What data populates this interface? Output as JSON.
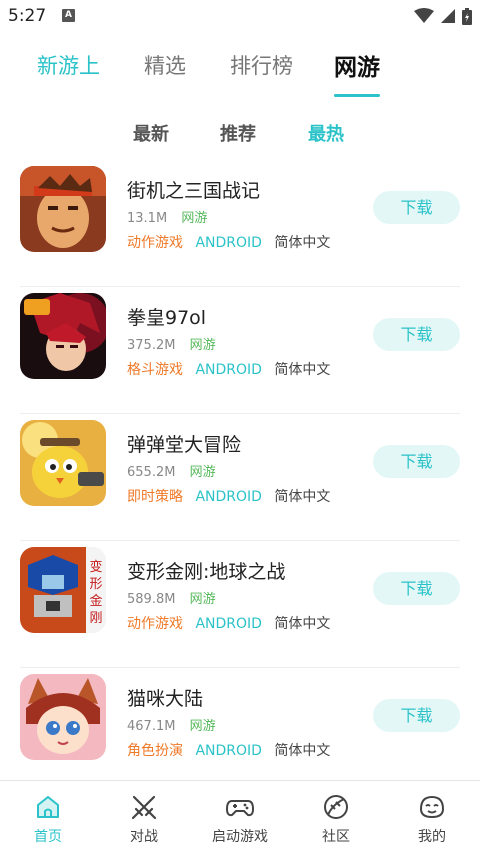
{
  "status_bar": {
    "time": "5:27",
    "notification_badge": "A"
  },
  "tabs": [
    {
      "label": "新游上",
      "state": "accent"
    },
    {
      "label": "精选",
      "state": "normal"
    },
    {
      "label": "排行榜",
      "state": "normal"
    },
    {
      "label": "网游",
      "state": "active"
    }
  ],
  "subtabs": [
    {
      "label": "最新",
      "active": false
    },
    {
      "label": "推荐",
      "active": false
    },
    {
      "label": "最热",
      "active": true
    }
  ],
  "games": [
    {
      "name": "街机之三国战记",
      "size": "13.1M",
      "type": "网游",
      "genre": "动作游戏",
      "platform": "ANDROID",
      "language": "简体中文",
      "button": "下载",
      "icon": "three-kingdoms-warrior-icon"
    },
    {
      "name": "拳皇97ol",
      "size": "375.2M",
      "type": "网游",
      "genre": "格斗游戏",
      "platform": "ANDROID",
      "language": "简体中文",
      "button": "下载",
      "icon": "kof-fighter-icon"
    },
    {
      "name": "弹弹堂大冒险",
      "size": "655.2M",
      "type": "网游",
      "genre": "即时策略",
      "platform": "ANDROID",
      "language": "简体中文",
      "button": "下载",
      "icon": "ddt-chick-icon"
    },
    {
      "name": "变形金刚:地球之战",
      "size": "589.8M",
      "type": "网游",
      "genre": "动作游戏",
      "platform": "ANDROID",
      "language": "简体中文",
      "button": "下载",
      "icon": "transformers-robot-icon",
      "icon_text": "变形金刚"
    },
    {
      "name": "猫咪大陆",
      "size": "467.1M",
      "type": "网游",
      "genre": "角色扮演",
      "platform": "ANDROID",
      "language": "简体中文",
      "button": "下载",
      "icon": "cat-girl-icon"
    }
  ],
  "bottom_nav": [
    {
      "label": "首页",
      "icon": "home-icon",
      "active": true
    },
    {
      "label": "对战",
      "icon": "crossed-swords-icon",
      "active": false
    },
    {
      "label": "启动游戏",
      "icon": "gamepad-icon",
      "active": false
    },
    {
      "label": "社区",
      "icon": "planet-icon",
      "active": false
    },
    {
      "label": "我的",
      "icon": "smiley-face-icon",
      "active": false
    }
  ],
  "colors": {
    "accent": "#2bc3c9",
    "genre": "#ef7a2a",
    "type": "#56b85b",
    "button_bg": "#e3f7f7"
  }
}
